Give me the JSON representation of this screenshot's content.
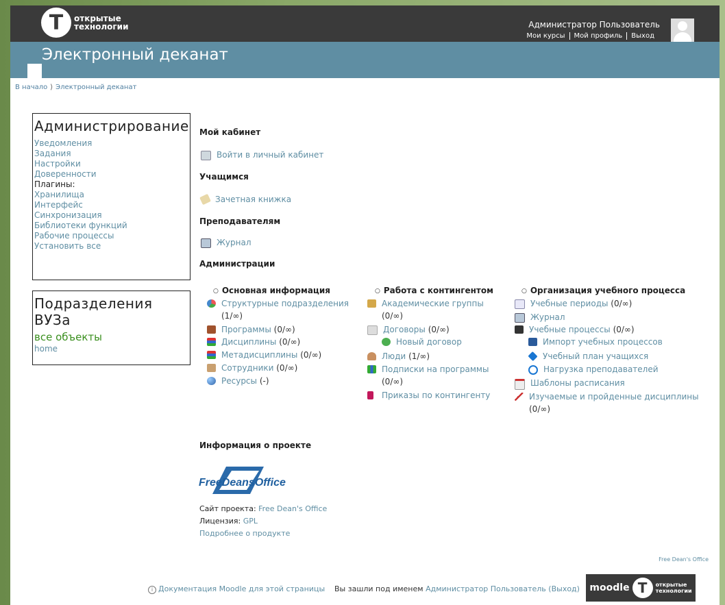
{
  "header": {
    "logo_line1": "открытые",
    "logo_line2": "технологии",
    "logo_glyph": "Т",
    "user_name": "Администратор Пользователь",
    "links": [
      "Мои курсы",
      "Мой профиль",
      "Выход"
    ]
  },
  "banner": {
    "title": "Электронный деканат"
  },
  "breadcrumb": {
    "home": "В начало",
    "sep": "⟩",
    "current": "Электронный деканат"
  },
  "admin_block": {
    "title": "Администрирование",
    "links_top": [
      "Уведомления",
      "Задания",
      "Настройки",
      "Доверенности"
    ],
    "plugins_label": "Плагины:",
    "links_bottom": [
      "Хранилища",
      "Интерфейс",
      "Синхронизация",
      "Библиотеки функций",
      "Рабочие процессы",
      "Установить все"
    ]
  },
  "units_block": {
    "title_line1": "Подразделения",
    "title_line2": "ВУЗа",
    "all": "все объекты",
    "home": "home"
  },
  "sections": {
    "cabinet": "Мой кабинет",
    "cabinet_link": "Войти в личный кабинет",
    "students": "Учащимся",
    "students_link": "Зачетная книжка",
    "teachers": "Преподавателям",
    "teachers_link": "Журнал",
    "admin": "Администрации"
  },
  "columns": {
    "c1": {
      "title": "Основная информация",
      "items": [
        {
          "label": "Структурные подразделения",
          "count": "(1/∞)"
        },
        {
          "label": "Программы",
          "count": "(0/∞)"
        },
        {
          "label": "Дисциплины",
          "count": "(0/∞)"
        },
        {
          "label": "Метадисциплины",
          "count": "(0/∞)"
        },
        {
          "label": "Сотрудники",
          "count": "(0/∞)"
        },
        {
          "label": "Ресурсы",
          "count": "(-)"
        }
      ]
    },
    "c2": {
      "title": "Работа с контингентом",
      "items": [
        {
          "label": "Академические группы",
          "count": "(0/∞)"
        },
        {
          "label": "Договоры",
          "count": "(0/∞)"
        },
        {
          "label": "Новый договор",
          "count": ""
        },
        {
          "label": "Люди",
          "count": "(1/∞)"
        },
        {
          "label": "Подписки на программы",
          "count": "(0/∞)"
        },
        {
          "label": "Приказы по контингенту",
          "count": ""
        }
      ]
    },
    "c3": {
      "title": "Организация учебного процесса",
      "items": [
        {
          "label": "Учебные периоды",
          "count": "(0/∞)"
        },
        {
          "label": "Журнал",
          "count": ""
        },
        {
          "label": "Учебные процессы",
          "count": "(0/∞)"
        },
        {
          "label": "Импорт учебных процессов",
          "count": ""
        },
        {
          "label": "Учебный план учащихся",
          "count": ""
        },
        {
          "label": "Нагрузка преподавателей",
          "count": ""
        },
        {
          "label": "Шаблоны расписания",
          "count": ""
        },
        {
          "label": "Изучаемые и пройденные дисциплины",
          "count": "(0/∞)"
        }
      ]
    }
  },
  "project": {
    "title": "Информация о проекте",
    "logo_text": "FreeDeansOffice",
    "site_label": "Сайт проекта:",
    "site_link": "Free Dean's Office",
    "license_label": "Лицензия:",
    "license_link": "GPL",
    "more": "Подробнее о продукте",
    "small_link": "Free Dean's Office"
  },
  "footer": {
    "docs": "Документация Moodle для этой страницы",
    "logged_as": "Вы зашли под именем",
    "user": "Администратор Пользователь",
    "logout": "(Выход)",
    "moodle": "moodle"
  }
}
